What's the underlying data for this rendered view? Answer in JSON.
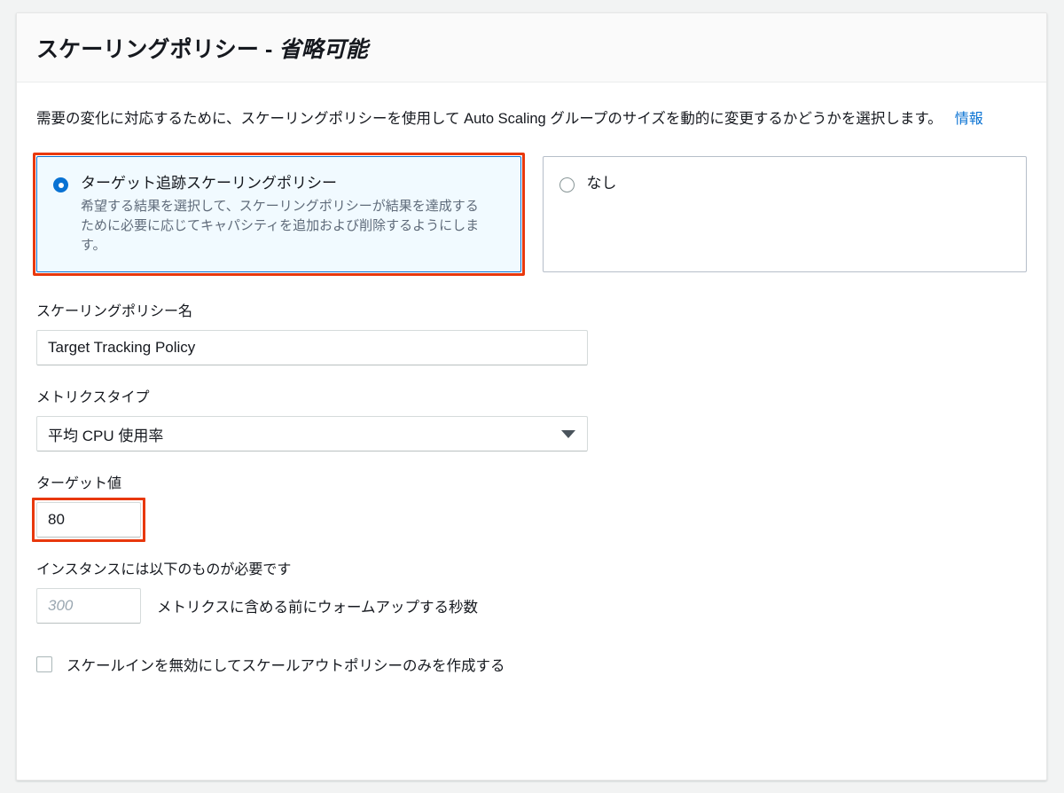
{
  "header": {
    "title_main": "スケーリングポリシー - ",
    "title_optional": "省略可能"
  },
  "description": {
    "text": "需要の変化に対応するために、スケーリングポリシーを使用して Auto Scaling グループのサイズを動的に変更するかどうかを選択します。",
    "info_link": "情報"
  },
  "policy_options": [
    {
      "id": "target-tracking",
      "label": "ターゲット追跡スケーリングポリシー",
      "description": "希望する結果を選択して、スケーリングポリシーが結果を達成するために必要に応じてキャパシティを追加および削除するようにします。",
      "selected": "true",
      "annotated": "true"
    },
    {
      "id": "none",
      "label": "なし",
      "description": "",
      "selected": "false",
      "annotated": "false"
    }
  ],
  "fields": {
    "policy_name": {
      "label": "スケーリングポリシー名",
      "value": "Target Tracking Policy",
      "placeholder": ""
    },
    "metric_type": {
      "label": "メトリクスタイプ",
      "value": "平均 CPU 使用率",
      "chevron": "chevron-down-icon"
    },
    "target_value": {
      "label": "ターゲット値",
      "value": "80",
      "annotated": "true"
    },
    "warmup": {
      "label": "インスタンスには以下のものが必要です",
      "placeholder": "300",
      "value": "",
      "suffix_text": "メトリクスに含める前にウォームアップする秒数"
    },
    "disable_scale_in": {
      "label": "スケールインを無効にしてスケールアウトポリシーのみを作成する",
      "checked": "false"
    }
  },
  "colors": {
    "accent_blue": "#0972d3",
    "annotation_red": "#e8380d",
    "selected_tile_bg": "#f1faff",
    "page_bg": "#f2f3f3",
    "header_bg": "#fafafa",
    "muted_text": "#5f6b7a"
  }
}
